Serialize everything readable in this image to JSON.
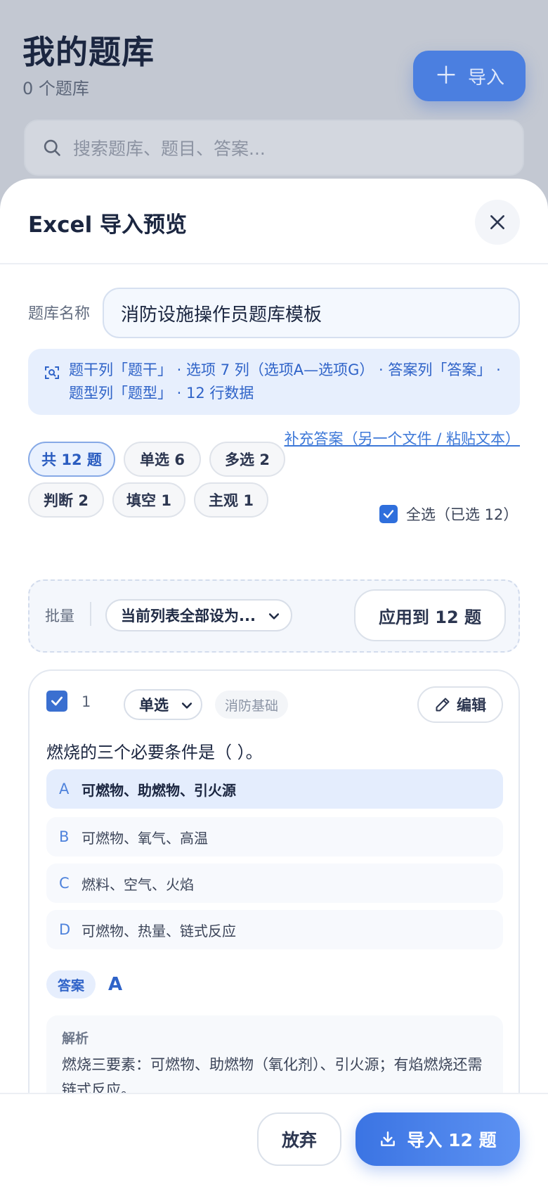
{
  "background": {
    "title": "我的题库",
    "count": "0 个题库",
    "import_label": "导入",
    "search_placeholder": "搜索题库、题目、答案..."
  },
  "sheet": {
    "title": "Excel 导入预览",
    "bank_name_label": "题库名称",
    "bank_name_value": "消防设施操作员题库模板",
    "detect_info": "题干列「题干」 · 选项 7 列（选项A—选项G） · 答案列「答案」 · 题型列「题型」 · 12 行数据",
    "supplement_link": "补充答案（另一个文件 / 粘贴文本）",
    "chips": [
      {
        "label": "共 12 题",
        "active": true
      },
      {
        "label": "单选 6",
        "active": false
      },
      {
        "label": "多选 2",
        "active": false
      },
      {
        "label": "判断 2",
        "active": false
      },
      {
        "label": "填空 1",
        "active": false
      },
      {
        "label": "主观 1",
        "active": false
      }
    ],
    "select_all_label": "全选（已选 12）",
    "batch": {
      "label": "批量",
      "select_value": "当前列表全部设为...",
      "apply_label": "应用到 12 题"
    },
    "question": {
      "number": "1",
      "type": "单选",
      "tag": "消防基础",
      "edit_label": "编辑",
      "stem": "燃烧的三个必要条件是（ ）。",
      "options": [
        {
          "letter": "A",
          "text": "可燃物、助燃物、引火源",
          "correct": true
        },
        {
          "letter": "B",
          "text": "可燃物、氧气、高温",
          "correct": false
        },
        {
          "letter": "C",
          "text": "燃料、空气、火焰",
          "correct": false
        },
        {
          "letter": "D",
          "text": "可燃物、热量、链式反应",
          "correct": false
        }
      ],
      "answer_label": "答案",
      "answer_value": "A",
      "analysis_label": "解析",
      "analysis_text": "燃烧三要素：可燃物、助燃物（氧化剂）、引火源；有焰燃烧还需链式反应。"
    },
    "footer": {
      "discard_label": "放弃",
      "import_label": "导入 12 题"
    }
  },
  "colors": {
    "accent": "#3b74e3",
    "info_bg": "#e7effd",
    "correct_bg": "#e4edfd"
  }
}
